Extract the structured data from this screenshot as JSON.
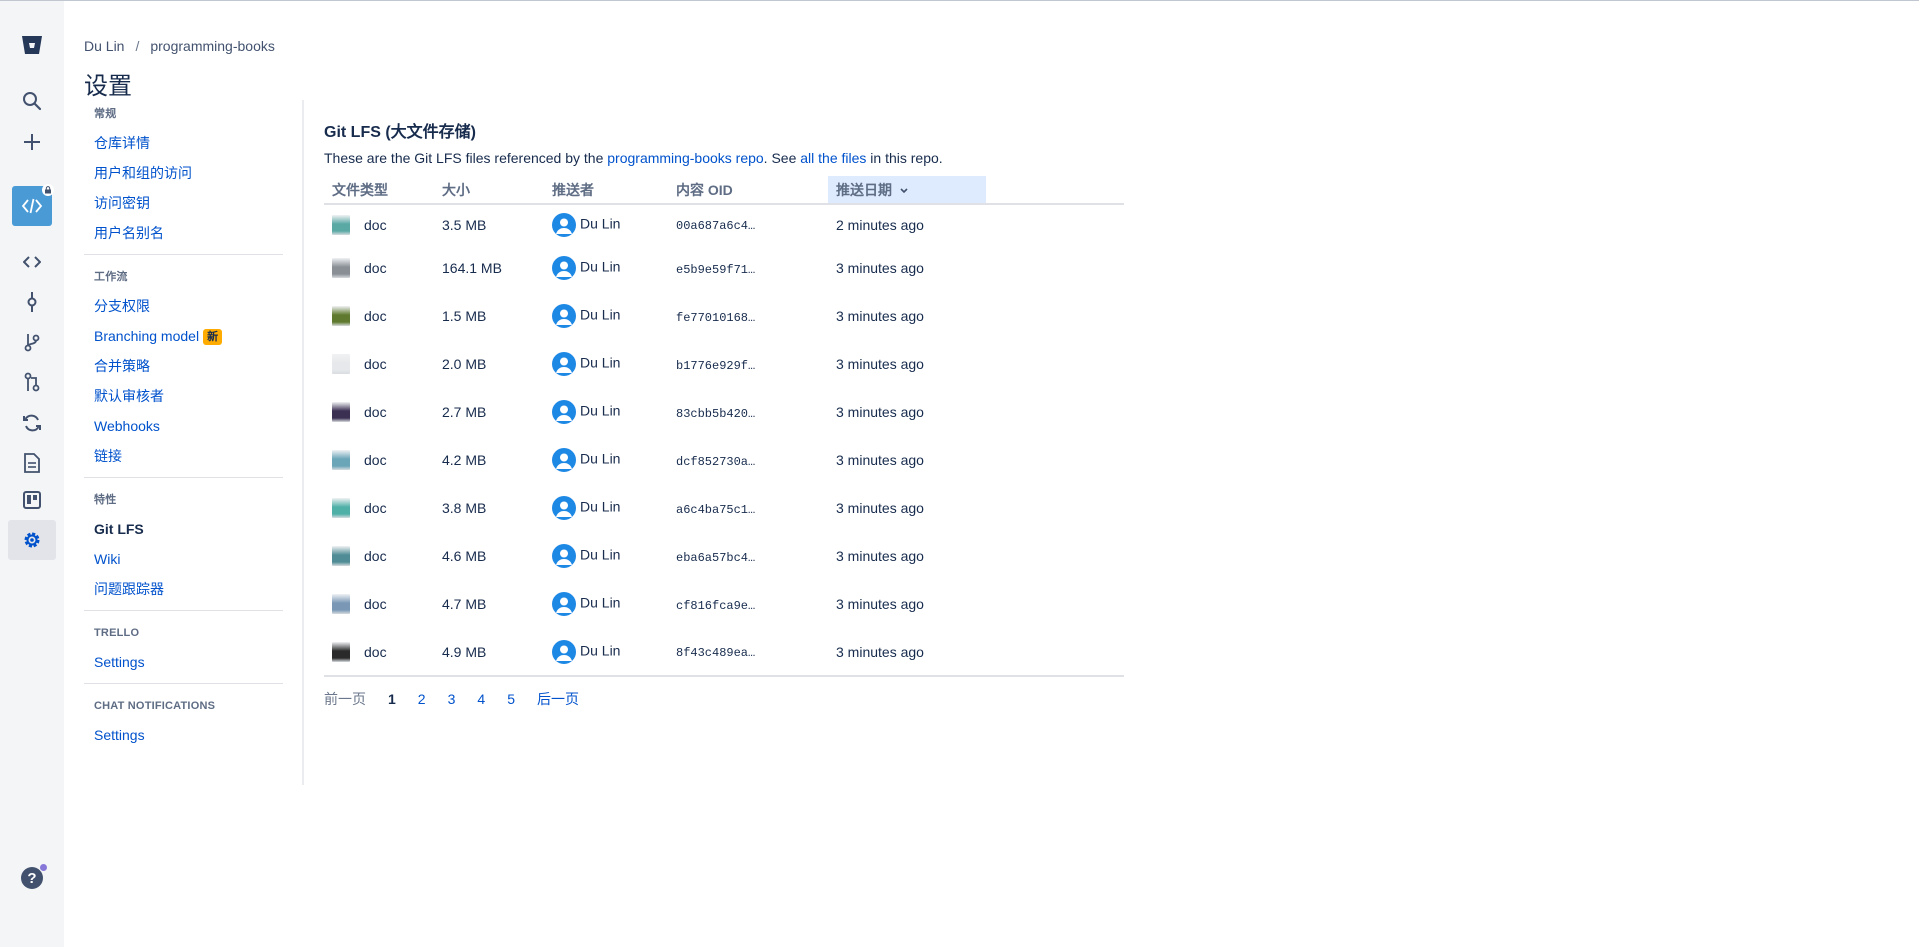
{
  "breadcrumb": {
    "owner": "Du Lin",
    "separator": "/",
    "repo": "programming-books"
  },
  "page": {
    "title": "设置"
  },
  "gnav": {
    "icons": [
      "bitbucket-logo-icon",
      "search-icon",
      "create-icon",
      "repo-avatar",
      "source-icon",
      "commits-icon",
      "branches-icon",
      "pull-requests-icon",
      "pipelines-icon",
      "wiki-icon",
      "trello-board-icon",
      "settings-icon",
      "help-icon"
    ],
    "accent": "#4a9ad6"
  },
  "sidebar": {
    "sections": [
      {
        "heading": "常规",
        "links": [
          "仓库详情",
          "用户和组的访问",
          "访问密钥",
          "用户名别名"
        ]
      },
      {
        "heading": "工作流",
        "links": [
          "分支权限",
          "Branching model",
          "合并策略",
          "默认审核者",
          "Webhooks",
          "链接"
        ],
        "badge": "新"
      },
      {
        "heading": "特性",
        "links": [
          "Git LFS",
          "Wiki",
          "问题跟踪器"
        ],
        "active": "Git LFS"
      },
      {
        "heading": "TRELLO",
        "links": [
          "Settings"
        ]
      },
      {
        "heading": "CHAT NOTIFICATIONS",
        "links": [
          "Settings"
        ]
      }
    ]
  },
  "main": {
    "title": "Git LFS (大文件存储)",
    "desc_prefix": "These are the Git LFS files referenced by the ",
    "desc_link1": "programming-books repo",
    "desc_mid": ". See ",
    "desc_link2": "all the files",
    "desc_suffix": " in this repo.",
    "columns": [
      "文件类型",
      "大小",
      "推送者",
      "内容 OID",
      "推送日期"
    ],
    "sort_icon": "chevron-down-icon",
    "rows": [
      {
        "type": "doc",
        "size": "3.5 MB",
        "pusher": "Du Lin",
        "oid": "00a687a6c4…",
        "date": "2 minutes ago",
        "thumb": "#5aa9a5"
      },
      {
        "type": "doc",
        "size": "164.1 MB",
        "pusher": "Du Lin",
        "oid": "e5b9e59f71…",
        "date": "3 minutes ago",
        "thumb": "#8a8f96"
      },
      {
        "type": "doc",
        "size": "1.5 MB",
        "pusher": "Du Lin",
        "oid": "fe77010168…",
        "date": "3 minutes ago",
        "thumb": "#5f7a2e"
      },
      {
        "type": "doc",
        "size": "2.0 MB",
        "pusher": "Du Lin",
        "oid": "b1776e929f…",
        "date": "3 minutes ago",
        "thumb": "#e6e8eb"
      },
      {
        "type": "doc",
        "size": "2.7 MB",
        "pusher": "Du Lin",
        "oid": "83cbb5b420…",
        "date": "3 minutes ago",
        "thumb": "#3b2f52"
      },
      {
        "type": "doc",
        "size": "4.2 MB",
        "pusher": "Du Lin",
        "oid": "dcf852730a…",
        "date": "3 minutes ago",
        "thumb": "#6aa5b8"
      },
      {
        "type": "doc",
        "size": "3.8 MB",
        "pusher": "Du Lin",
        "oid": "a6c4ba75c1…",
        "date": "3 minutes ago",
        "thumb": "#4fb0a8"
      },
      {
        "type": "doc",
        "size": "4.6 MB",
        "pusher": "Du Lin",
        "oid": "eba6a57bc4…",
        "date": "3 minutes ago",
        "thumb": "#4f8c95"
      },
      {
        "type": "doc",
        "size": "4.7 MB",
        "pusher": "Du Lin",
        "oid": "cf816fca9e…",
        "date": "3 minutes ago",
        "thumb": "#7a98b5"
      },
      {
        "type": "doc",
        "size": "4.9 MB",
        "pusher": "Du Lin",
        "oid": "8f43c489ea…",
        "date": "3 minutes ago",
        "thumb": "#2a2a2a"
      }
    ],
    "pagination": {
      "prev": "前一页",
      "current": "1",
      "pages": [
        "2",
        "3",
        "4",
        "5"
      ],
      "next": "后一页"
    }
  }
}
